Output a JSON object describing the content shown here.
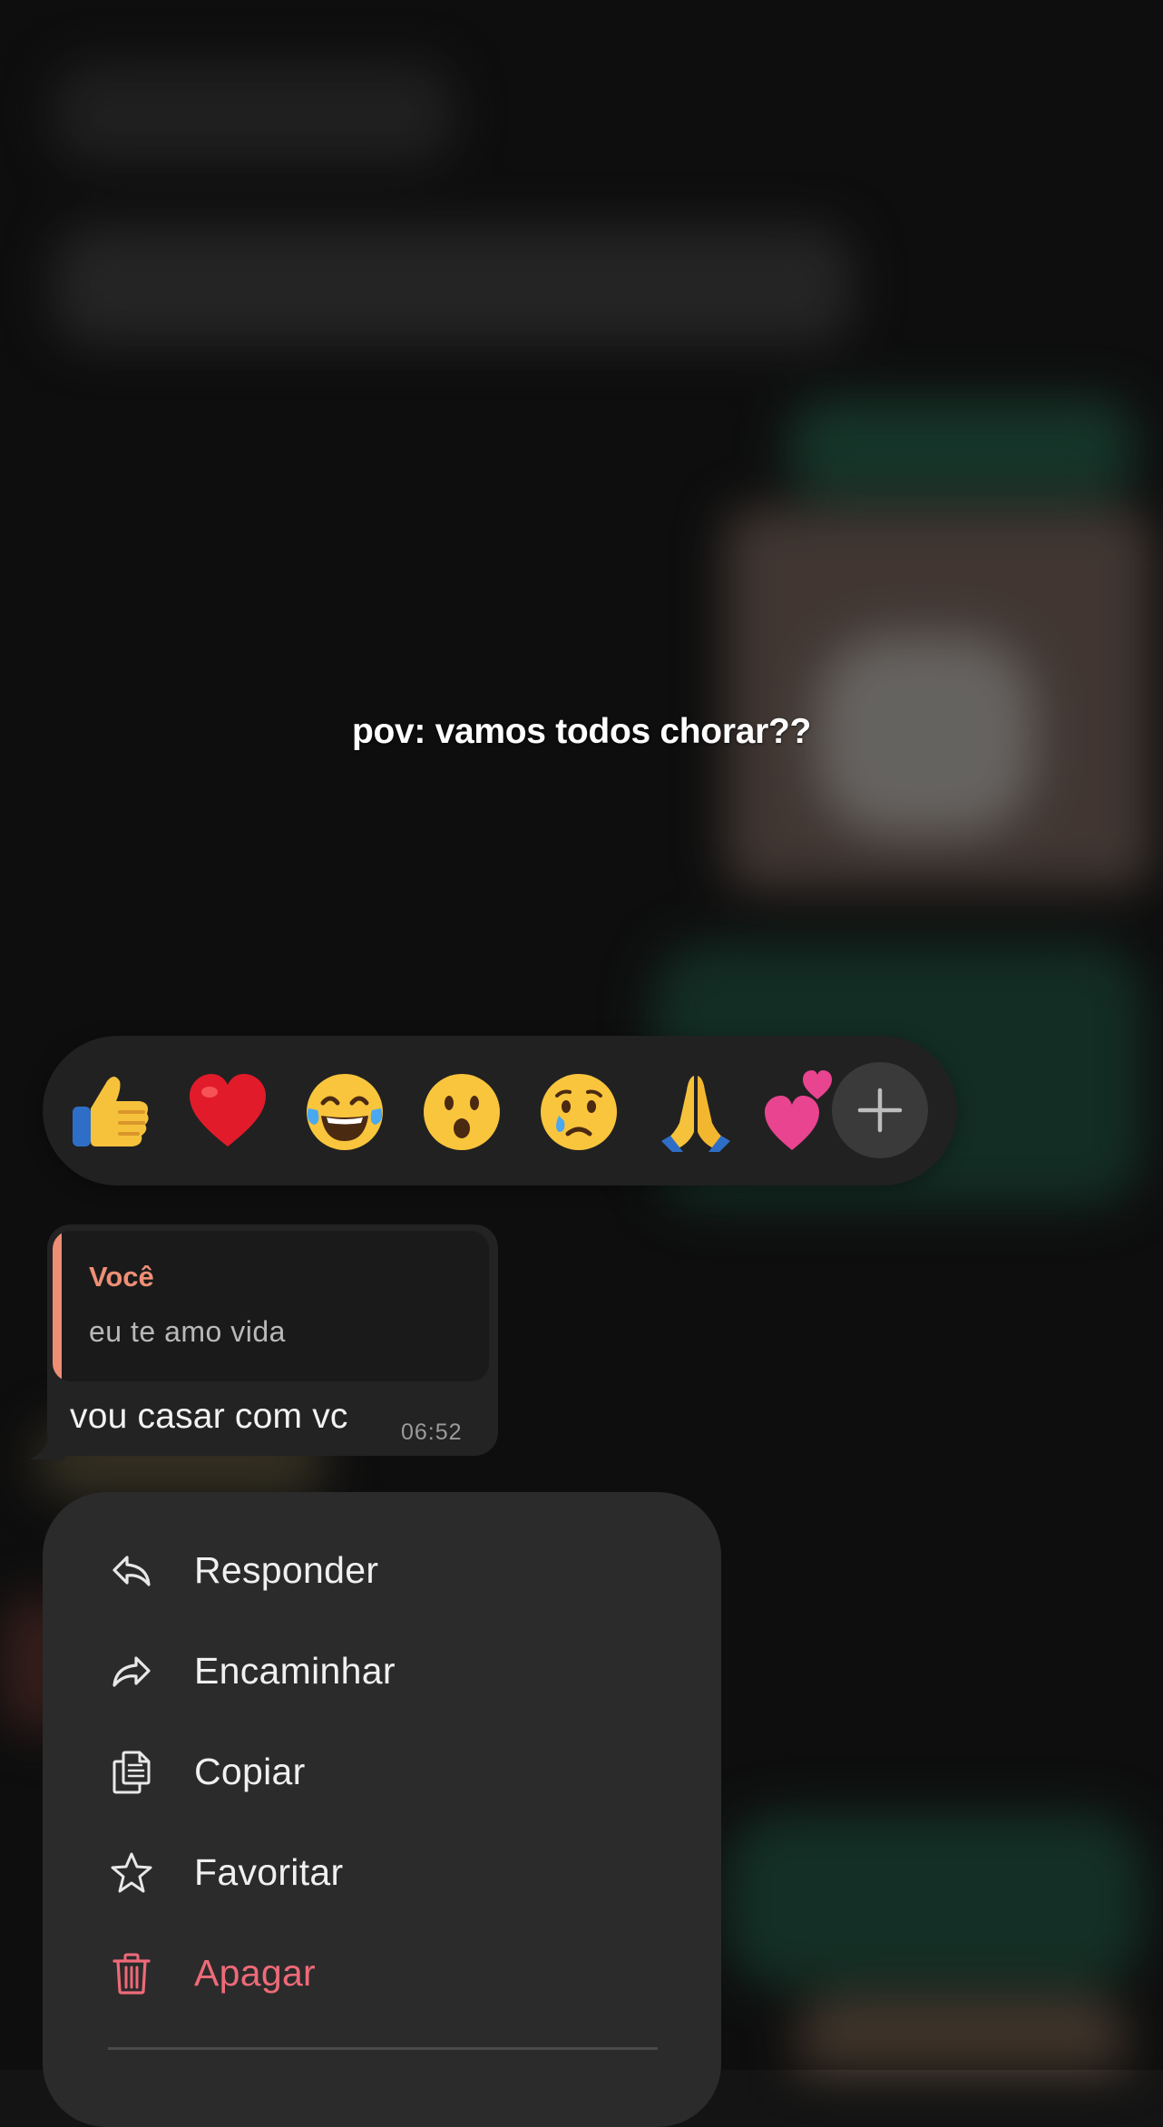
{
  "story": {
    "caption": "pov: vamos todos chorar??"
  },
  "reactions": {
    "items": [
      {
        "name": "thumbs-up",
        "glyph": "👍"
      },
      {
        "name": "red-heart",
        "glyph": "❤️"
      },
      {
        "name": "tears-of-joy",
        "glyph": "😂"
      },
      {
        "name": "surprised-face",
        "glyph": "😮"
      },
      {
        "name": "crying-face",
        "glyph": "😢"
      },
      {
        "name": "folded-hands",
        "glyph": "🙏"
      },
      {
        "name": "two-hearts",
        "glyph": "💕"
      }
    ],
    "add_icon": "plus-icon"
  },
  "message": {
    "quote_author": "Você",
    "quote_text": "eu te amo vida",
    "text": "vou casar com vc",
    "time": "06:52"
  },
  "menu": {
    "items": [
      {
        "label": "Responder",
        "icon": "reply-icon"
      },
      {
        "label": "Encaminhar",
        "icon": "forward-icon"
      },
      {
        "label": "Copiar",
        "icon": "copy-icon"
      },
      {
        "label": "Favoritar",
        "icon": "star-icon"
      },
      {
        "label": "Apagar",
        "icon": "trash-icon"
      }
    ]
  },
  "colors": {
    "quote_accent": "#ee8f75",
    "danger": "#ef6a78",
    "bubble": "#232323",
    "menu_bg": "#2b2b2b"
  }
}
